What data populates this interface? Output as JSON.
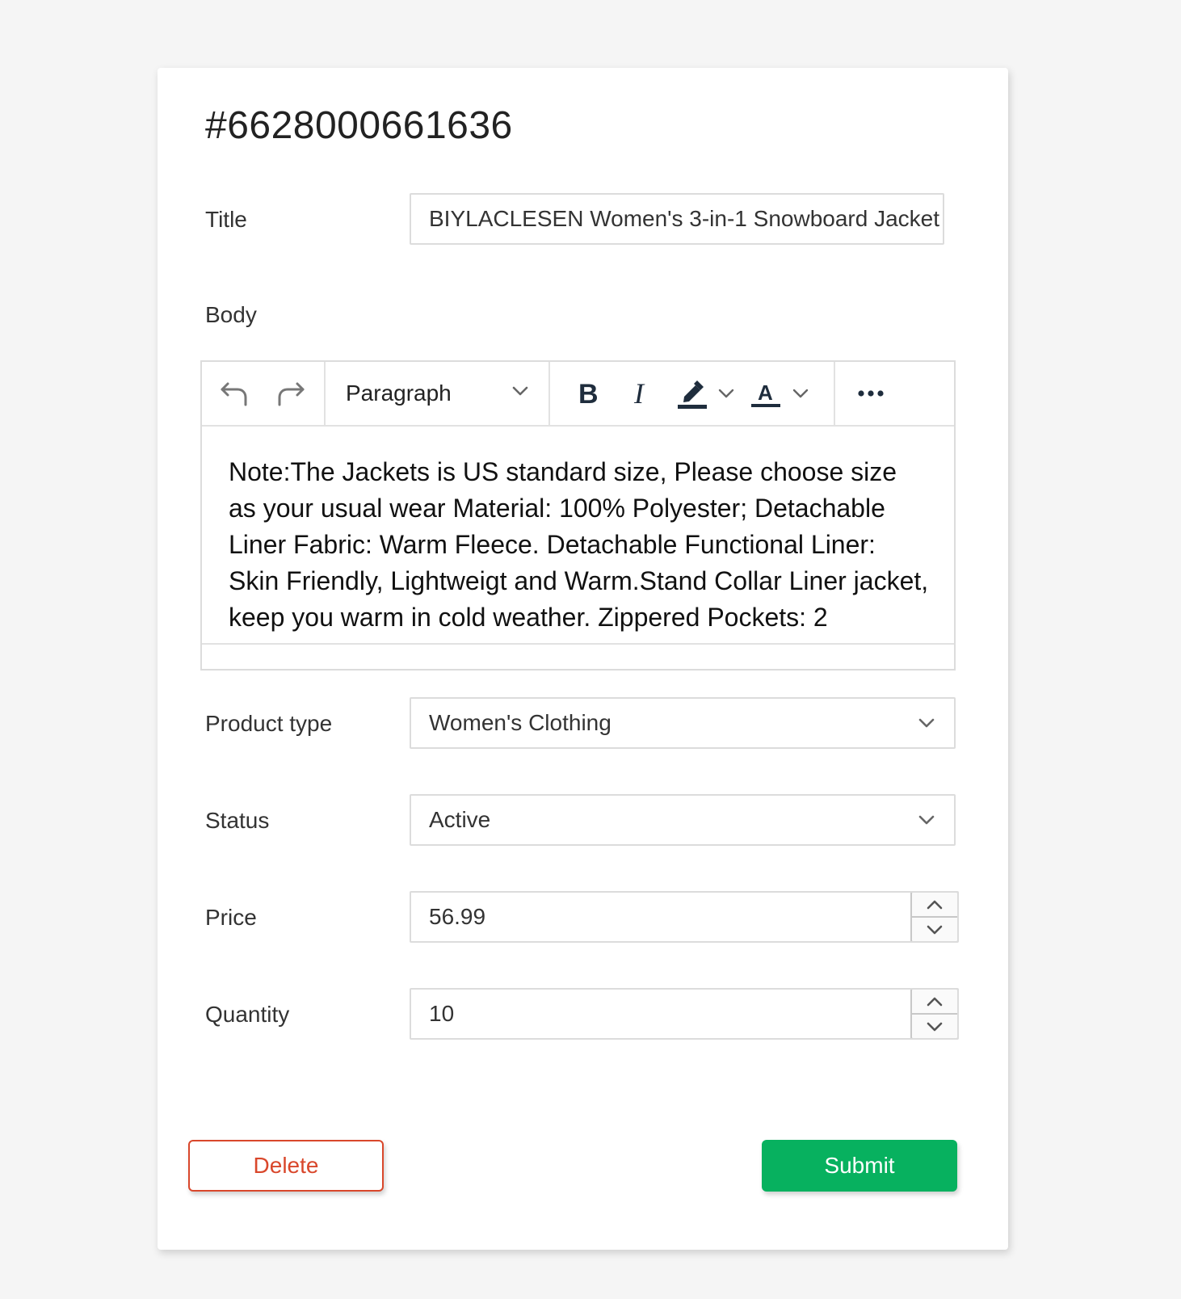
{
  "product": {
    "id": "#6628000661636"
  },
  "form": {
    "title_label": "Title",
    "title_value": "BIYLACLESEN Women's 3-in-1 Snowboard Jacket",
    "body_label": "Body",
    "product_type_label": "Product type",
    "product_type_value": "Women's Clothing",
    "status_label": "Status",
    "status_value": "Active",
    "price_label": "Price",
    "price_value": "56.99",
    "quantity_label": "Quantity",
    "quantity_value": "10"
  },
  "editor": {
    "block_format": "Paragraph",
    "toolbar_icons": [
      "undo-icon",
      "redo-icon",
      "chevron-down-icon",
      "bold-icon",
      "italic-icon",
      "highlight-icon",
      "font-color-icon",
      "more-icon"
    ],
    "content": "Note:The Jackets is US standard size, Please choose size as your usual wear Material: 100% Polyester; Detachable Liner Fabric: Warm Fleece. Detachable Functional Liner: Skin Friendly, Lightweigt and Warm.Stand Collar Liner jacket, keep you warm in cold weather. Zippered Pockets: 2"
  },
  "buttons": {
    "delete": "Delete",
    "submit": "Submit"
  },
  "colors": {
    "danger": "#d9472b",
    "primary": "#07b15f",
    "highlight_bar": "#1f2d3d"
  }
}
